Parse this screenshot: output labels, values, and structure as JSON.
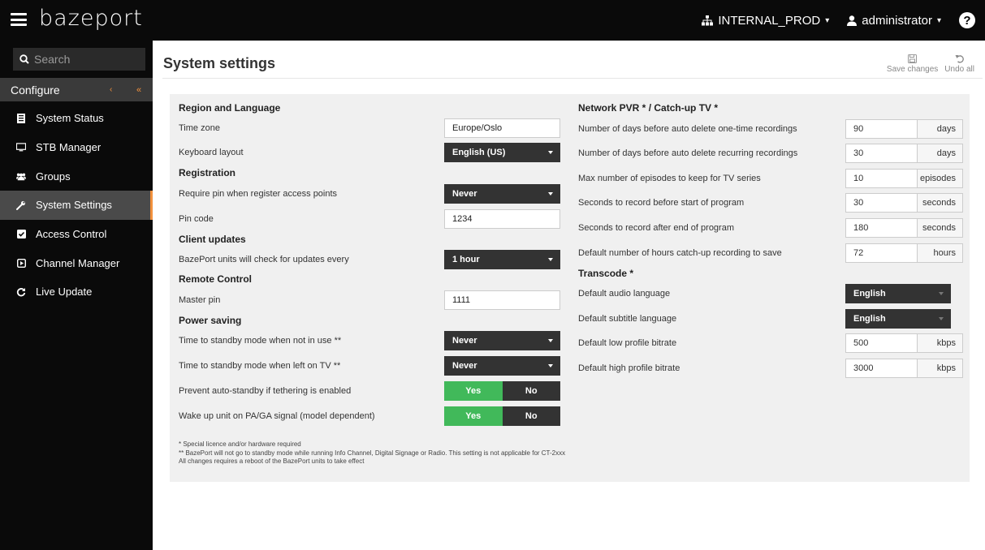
{
  "header": {
    "logo": "bazeport",
    "env": "INTERNAL_PROD",
    "user": "administrator",
    "help": "?"
  },
  "sidebar": {
    "search_placeholder": "Search",
    "configure": "Configure",
    "collapse_glyph": "‹",
    "collapse_all_glyph": "«",
    "items": [
      {
        "label": "System Status",
        "icon": "server-icon"
      },
      {
        "label": "STB Manager",
        "icon": "monitor-icon"
      },
      {
        "label": "Groups",
        "icon": "users-icon"
      },
      {
        "label": "System Settings",
        "icon": "wrench-icon"
      },
      {
        "label": "Access Control",
        "icon": "checkbox-icon"
      },
      {
        "label": "Channel Manager",
        "icon": "play-square-icon"
      },
      {
        "label": "Live Update",
        "icon": "refresh-icon"
      }
    ],
    "active_index": 3
  },
  "main": {
    "title": "System settings",
    "save_label": "Save changes",
    "undo_label": "Undo all"
  },
  "left": {
    "region_title": "Region and Language",
    "timezone_label": "Time zone",
    "timezone_value": "Europe/Oslo",
    "keyboard_label": "Keyboard layout",
    "keyboard_value": "English (US)",
    "registration_title": "Registration",
    "require_pin_label": "Require pin when register access points",
    "require_pin_value": "Never",
    "pin_code_label": "Pin code",
    "pin_code_value": "1234",
    "client_updates_title": "Client updates",
    "check_updates_label": "BazePort units will check for updates every",
    "check_updates_value": "1 hour",
    "remote_title": "Remote Control",
    "master_pin_label": "Master pin",
    "master_pin_value": "1111",
    "power_title": "Power saving",
    "standby_unused_label": "Time to standby mode when not in use **",
    "standby_unused_value": "Never",
    "standby_left_label": "Time to standby mode when left on TV **",
    "standby_left_value": "Never",
    "tethering_label": "Prevent auto-standby if tethering is enabled",
    "wakeup_label": "Wake up unit on PA/GA signal (model dependent)",
    "yes": "Yes",
    "no": "No"
  },
  "right": {
    "pvr_title": "Network PVR * / Catch-up TV *",
    "rows": [
      {
        "label": "Number of days before auto delete one-time recordings",
        "value": "90",
        "unit": "days"
      },
      {
        "label": "Number of days before auto delete recurring recordings",
        "value": "30",
        "unit": "days"
      },
      {
        "label": "Max number of episodes to keep for TV series",
        "value": "10",
        "unit": "episodes"
      },
      {
        "label": "Seconds to record before start of program",
        "value": "30",
        "unit": "seconds"
      },
      {
        "label": "Seconds to record after end of program",
        "value": "180",
        "unit": "seconds"
      },
      {
        "label": "Default number of hours catch-up recording to save",
        "value": "72",
        "unit": "hours"
      }
    ],
    "transcode_title": "Transcode *",
    "audio_label": "Default audio language",
    "audio_value": "English",
    "subtitle_label": "Default subtitle language",
    "subtitle_value": "English",
    "low_label": "Default low profile bitrate",
    "low_value": "500",
    "low_unit": "kbps",
    "high_label": "Default high profile bitrate",
    "high_value": "3000",
    "high_unit": "kbps"
  },
  "notes": {
    "line1": "* Special licence and/or hardware required",
    "line2": "** BazePort will not go to standby mode while running Info Channel, Digital Signage or Radio. This setting is not applicable for CT-2xxx",
    "line3": "All changes requires a reboot of the BazePort units to take effect"
  },
  "colors": {
    "accent": "#f2913d",
    "toggle_on": "#41b95a",
    "dark": "#0a0a0a"
  }
}
